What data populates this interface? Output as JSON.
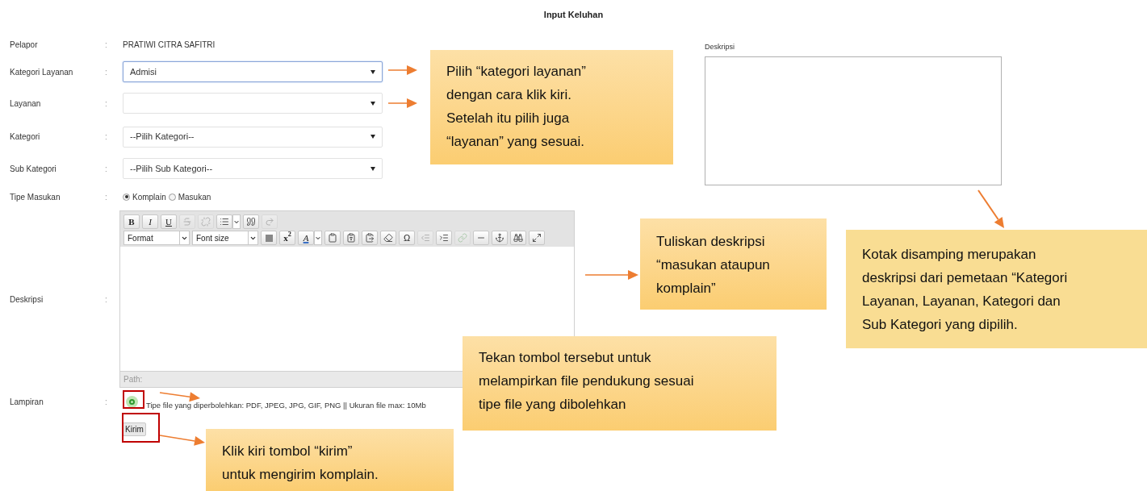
{
  "title": "Input Keluhan",
  "fields": [
    {
      "label": "Pelapor",
      "separator": ":",
      "kind": "text",
      "value": "PRATIWI CITRA SAFITRI"
    },
    {
      "label": "Kategori Layanan",
      "separator": ":",
      "kind": "select",
      "value": "Admisi",
      "focused": true
    },
    {
      "label": "Layanan",
      "separator": ":",
      "kind": "select",
      "focused": false
    },
    {
      "label": "Kategori",
      "separator": ":",
      "kind": "select",
      "value": "--Pilih Kategori--",
      "focused": false
    },
    {
      "label": "Sub Kategori",
      "separator": ":",
      "kind": "select",
      "value": "--Pilih Sub Kategori--",
      "focused": false
    },
    {
      "label": "Tipe Masukan",
      "separator": ":",
      "kind": "radio",
      "options": [
        {
          "label": "Komplain",
          "selected": true
        },
        {
          "label": "Masukan",
          "selected": false
        }
      ]
    },
    {
      "label": "Deskripsi",
      "separator": ":",
      "kind": "editor",
      "path_label": "Path:",
      "toolbar": [
        [
          {
            "kind": "bold",
            "text": "B"
          },
          {
            "kind": "italic",
            "text": "I"
          },
          {
            "kind": "underline",
            "text": "U"
          },
          {
            "kind": "strike",
            "disabled": true
          },
          {
            "kind": "unlink",
            "disabled": true
          },
          {
            "kind": "list",
            "disabled": false
          },
          {
            "kind": "quote",
            "disabled": false
          },
          {
            "kind": "undo",
            "disabled": true
          }
        ],
        [
          {
            "kind": "dropdown",
            "text": "Format"
          },
          {
            "kind": "dropdown",
            "text": "Font size"
          },
          {
            "kind": "block",
            "disabled": false
          },
          {
            "kind": "superscript",
            "text": "x$^{2}$"
          },
          {
            "kind": "text-color",
            "text": "A"
          },
          {
            "kind": "paste",
            "disabled": false
          },
          {
            "kind": "paste-text",
            "disabled": false
          },
          {
            "kind": "paste-word",
            "disabled": false
          },
          {
            "kind": "eraser",
            "disabled": false
          },
          {
            "kind": "glyph",
            "text": "Ω"
          },
          {
            "kind": "outdent",
            "disabled": true
          },
          {
            "kind": "indent",
            "disabled": false
          },
          {
            "kind": "link",
            "disabled": true
          },
          {
            "kind": "rule",
            "disabled": false
          },
          {
            "kind": "anchor",
            "disabled": false
          },
          {
            "kind": "find",
            "disabled": false
          },
          {
            "kind": "expand",
            "disabled": false
          }
        ]
      ]
    },
    {
      "label": "Lampiran",
      "separator": ":",
      "kind": "file",
      "hint": "Tipe file yang diperbolehkan: PDF, JPEG, JPG, GIF, PNG || Ukuran file max: 10Mb"
    }
  ],
  "submit": "Kirim",
  "side_panel": {
    "label": "Deskripsi"
  },
  "callouts": [
    {
      "text": "Pilih “kategori layanan”\ndengan cara klik kiri.\nSetelah itu pilih juga\n“layanan” yang sesuai.",
      "kind": "gradient"
    },
    {
      "text": "Tuliskan deskripsi\n“masukan ataupun\nkomplain”",
      "kind": "gradient"
    },
    {
      "text": "Kotak disamping merupakan\ndeskripsi dari pemetaan “Kategori\nLayanan, Layanan, Kategori dan\nSub Kategori yang dipilih.",
      "kind": "flat"
    },
    {
      "text": "Tekan tombol tersebut untuk\nmelampirkan file pendukung sesuai\ntipe file yang dibolehkan",
      "kind": "gradient"
    },
    {
      "text": "Klik kiri tombol “kirim”\nuntuk mengirim komplain.",
      "kind": "gradient"
    }
  ]
}
